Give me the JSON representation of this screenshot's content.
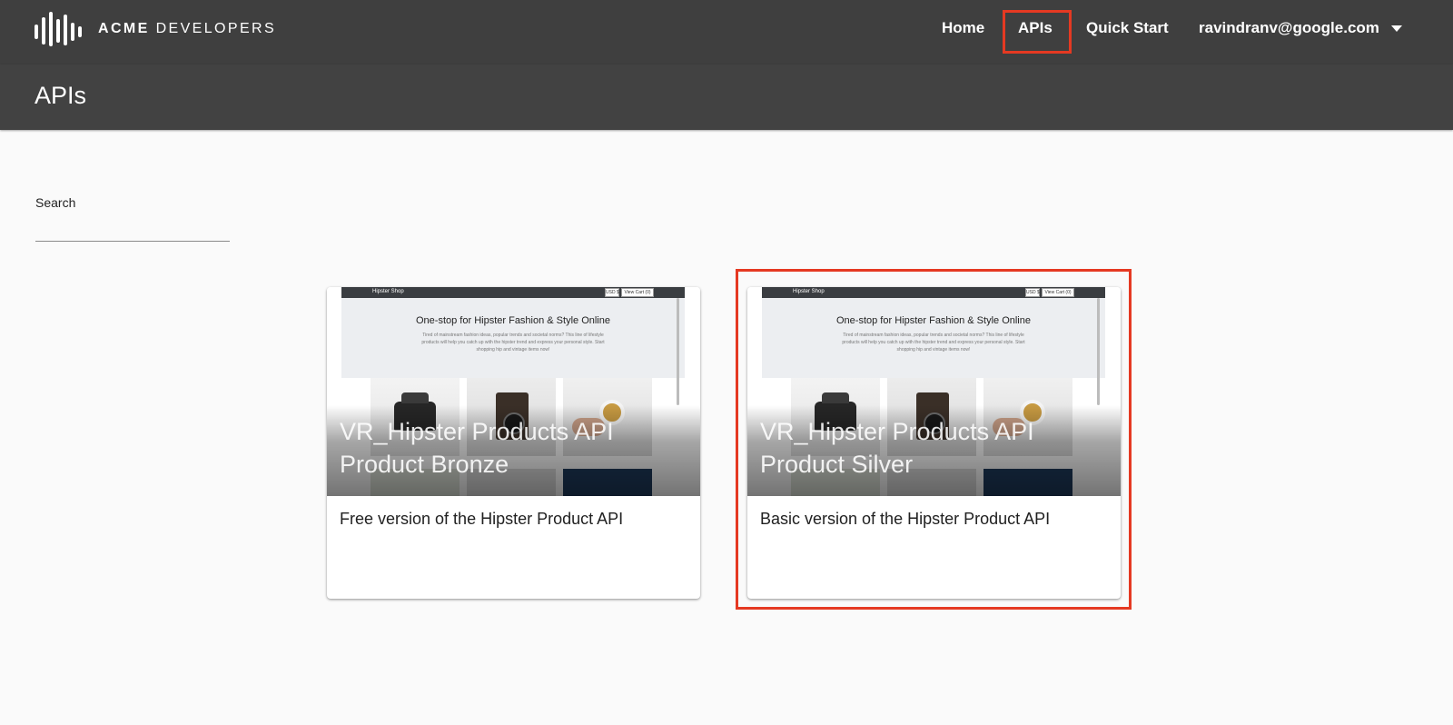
{
  "brand": {
    "name_bold": "ACME",
    "name_rest": " DEVELOPERS"
  },
  "nav": {
    "home": "Home",
    "apis": "APIs",
    "quick_start": "Quick Start",
    "user": "ravindranv@google.com"
  },
  "page": {
    "title": "APIs"
  },
  "search": {
    "label": "Search",
    "value": ""
  },
  "preview": {
    "shop_name": "Hipster Shop",
    "currency": "USD $",
    "cart": "View Cart (0)",
    "heading": "One-stop for Hipster Fashion & Style Online",
    "sub": "Tired of mainstream fashion ideas, popular trends and societal norms? This line of lifestyle products will help you catch up with the hipster trend and express your personal style. Start shopping hip and vintage items now!"
  },
  "cards": [
    {
      "title": "VR_Hipster Products API Product Bronze",
      "description": "Free version of the Hipster Product API"
    },
    {
      "title": "VR_Hipster Products API Product Silver",
      "description": "Basic version of the Hipster Product API"
    }
  ],
  "colors": {
    "topbar": "#3f3f3f",
    "header": "#424242",
    "highlight": "#e53922",
    "background": "#fafafa"
  }
}
